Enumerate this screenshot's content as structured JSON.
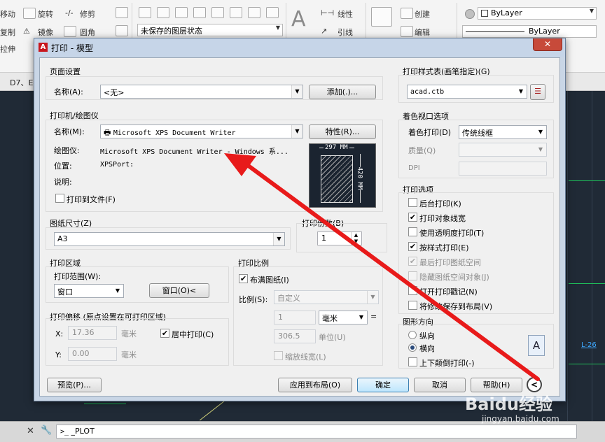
{
  "ribbon": {
    "modify": {
      "items": [
        "移动",
        "旋转",
        "修剪",
        "复制",
        "镜像",
        "圆角",
        "拉伸"
      ]
    },
    "layers": {
      "state_combo": "未保存的图层状态"
    },
    "annotation": {
      "items": [
        "线性",
        "引线"
      ]
    },
    "block": {
      "items": [
        "创建",
        "编辑"
      ]
    },
    "properties": {
      "color": "ByLayer",
      "linetype": "ByLayer"
    }
  },
  "tab_strip": {
    "partial_label": "D7、E"
  },
  "dialog": {
    "title": "打印 - 模型",
    "page_setup": {
      "group_label": "页面设置",
      "name_label": "名称(A):",
      "name_value": "<无>",
      "add_button": "添加(.)..."
    },
    "printer": {
      "group_label": "打印机/绘图仪",
      "name_label": "名称(M):",
      "name_value": "Microsoft XPS Document Writer",
      "properties_button": "特性(R)...",
      "plotter_label": "绘图仪:",
      "plotter_value": "Microsoft XPS Document Writer - Windows 系...",
      "location_label": "位置:",
      "location_value": "XPSPort:",
      "description_label": "说明:",
      "print_to_file_label": "打印到文件(F)",
      "print_to_file_checked": false,
      "preview_width": "297 MM",
      "preview_height": "420 MM"
    },
    "paper_size": {
      "group_label": "图纸尺寸(Z)",
      "value": "A3"
    },
    "copies": {
      "group_label": "打印份数(B)",
      "value": "1"
    },
    "plot_area": {
      "group_label": "打印区域",
      "range_label": "打印范围(W):",
      "range_value": "窗口",
      "window_button": "窗口(O)<"
    },
    "plot_offset": {
      "group_label": "打印偏移 (原点设置在可打印区域)",
      "x_label": "X:",
      "x_value": "17.36",
      "y_label": "Y:",
      "y_value": "0.00",
      "unit": "毫米",
      "center_label": "居中打印(C)",
      "center_checked": true
    },
    "plot_scale": {
      "group_label": "打印比例",
      "fit_label": "布满图纸(I)",
      "fit_checked": true,
      "scale_label": "比例(S):",
      "scale_value": "自定义",
      "value1": "1",
      "unit_value": "毫米",
      "equals": "=",
      "value2": "306.5",
      "unit2_label": "单位(U)",
      "lineweights_label": "缩放线宽(L)",
      "lineweights_checked": false
    },
    "plot_style_table": {
      "group_label": "打印样式表(画笔指定)(G)",
      "value": "acad.ctb"
    },
    "shaded_viewport": {
      "group_label": "着色视口选项",
      "shade_label": "着色打印(D)",
      "shade_value": "传统线框",
      "quality_label": "质量(Q)",
      "dpi_label": "DPI"
    },
    "plot_options": {
      "group_label": "打印选项",
      "items": [
        {
          "label": "后台打印(K)",
          "checked": false,
          "disabled": false
        },
        {
          "label": "打印对象线宽",
          "checked": true,
          "disabled": false
        },
        {
          "label": "使用透明度打印(T)",
          "checked": false,
          "disabled": false
        },
        {
          "label": "按样式打印(E)",
          "checked": true,
          "disabled": false
        },
        {
          "label": "最后打印图纸空间",
          "checked": true,
          "disabled": true
        },
        {
          "label": "隐藏图纸空间对象(J)",
          "checked": false,
          "disabled": true
        },
        {
          "label": "打开打印戳记(N)",
          "checked": false,
          "disabled": false
        },
        {
          "label": "将修改保存到布局(V)",
          "checked": false,
          "disabled": false
        }
      ]
    },
    "orientation": {
      "group_label": "图形方向",
      "portrait_label": "纵向",
      "landscape_label": "横向",
      "selected": "横向",
      "upside_down_label": "上下颠倒打印(-)",
      "upside_down_checked": false,
      "icon_letter": "A"
    },
    "buttons": {
      "preview": "预览(P)...",
      "apply": "应用到布局(O)",
      "ok": "确定",
      "cancel": "取消",
      "help": "帮助(H)"
    }
  },
  "command_line": {
    "text": "_PLOT"
  },
  "drawing_labels": {
    "label_a": "L-26"
  },
  "watermark": {
    "text": "Baidu经验",
    "url": "jingyan.baidu.com"
  },
  "colors": {
    "arrow": "#e81a1a",
    "drawing_bg": "#202a36",
    "dialog_frame": "#c9d6e6",
    "ok_button_border": "#3c7fb1"
  }
}
